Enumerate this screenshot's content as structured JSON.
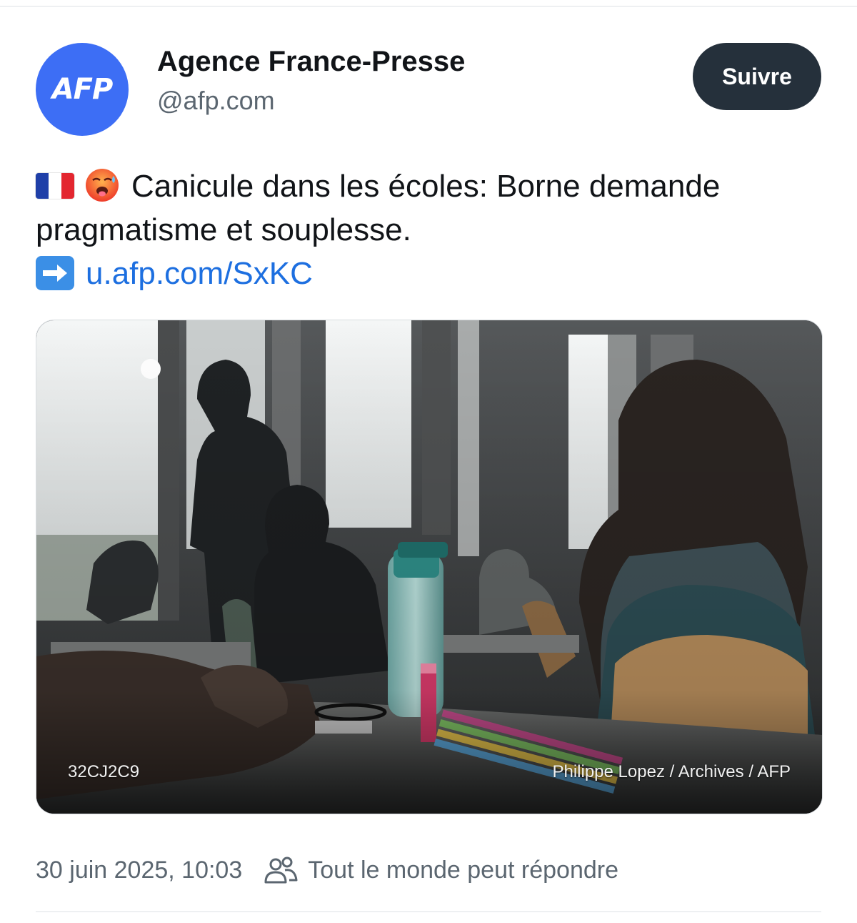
{
  "account": {
    "avatar_text": "AFP",
    "display_name": "Agence France-Presse",
    "handle": "@afp.com",
    "follow_label": "Suivre",
    "avatar_color": "#3d6ef5"
  },
  "post": {
    "flag_icon": "france-flag-icon",
    "emoji_icon": "hot-face-emoji-icon",
    "text_line1": "Canicule dans les écoles: Borne demande",
    "text_line2": "pragmatisme et souplesse.",
    "arrow_icon": "right-arrow-emoji-icon",
    "link": "u.afp.com/SxKC",
    "link_color": "#1d6fe0"
  },
  "media": {
    "code": "32CJ2C9",
    "credit": "Philippe Lopez / Archives / AFP"
  },
  "meta": {
    "timestamp": "30 juin 2025, 10:03",
    "reply_icon": "people-icon",
    "reply_scope": "Tout le monde peut répondre"
  }
}
